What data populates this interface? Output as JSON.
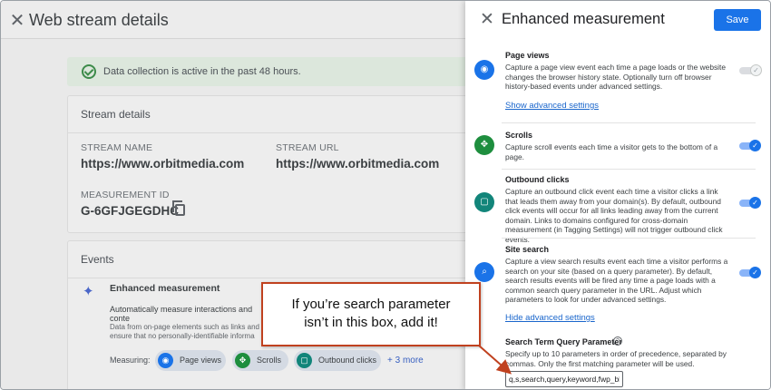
{
  "stream_page": {
    "close_icon": "close-icon",
    "title": "Web stream details",
    "notice": "Data collection is active in the past 48 hours.",
    "stream_details": {
      "heading": "Stream details",
      "stream_name_label": "STREAM NAME",
      "stream_name_value": "https://www.orbitmedia.com",
      "stream_url_label": "STREAM URL",
      "stream_url_value": "https://www.orbitmedia.com",
      "measurement_id_label": "MEASUREMENT ID",
      "measurement_id_value": "G-6GFJGEGDHC"
    },
    "events": {
      "heading": "Events",
      "em_title": "Enhanced measurement",
      "em_desc_line1": "Automatically measure interactions and conte",
      "em_desc_line2": "Data from on-page elements such as links and",
      "em_desc_line3": "ensure that no personally-identifiable informa",
      "measuring_label": "Measuring:",
      "chips": [
        "Page views",
        "Scrolls",
        "Outbound clicks"
      ],
      "more": "+ 3 more"
    }
  },
  "panel": {
    "title": "Enhanced measurement",
    "save_label": "Save",
    "sections": {
      "page_views": {
        "title": "Page views",
        "desc": "Capture a page view event each time a page loads or the website changes the browser history state. Optionally turn off browser history-based events under advanced settings.",
        "link": "Show advanced settings",
        "enabled": true
      },
      "scrolls": {
        "title": "Scrolls",
        "desc": "Capture scroll events each time a visitor gets to the bottom of a page.",
        "enabled": true
      },
      "outbound_clicks": {
        "title": "Outbound clicks",
        "desc": "Capture an outbound click event each time a visitor clicks a link that leads them away from your domain(s). By default, outbound click events will occur for all links leading away from the current domain. Links to domains configured for cross-domain measurement (in Tagging Settings) will not trigger outbound click events.",
        "enabled": true
      },
      "site_search": {
        "title": "Site search",
        "desc": "Capture a view search results event each time a visitor performs a search on your site (based on a query parameter). By default, search results events will be fired any time a page loads with a common search query parameter in the URL. Adjust which parameters to look for under advanced settings.",
        "link": "Hide advanced settings",
        "enabled": true
      }
    },
    "search_param": {
      "label": "Search Term Query Parameter",
      "desc": "Specify up to 10 parameters in order of precedence, separated by commas. Only the first matching parameter will be used.",
      "value": "q,s,search,query,keyword,fwp_blo"
    }
  },
  "callout": {
    "line1": "If you’re search parameter",
    "line2": "isn’t in this box, add it!"
  },
  "colors": {
    "accent": "#1a73e8",
    "callout_border": "#c0411f",
    "notice_bg": "#dce7dc"
  }
}
